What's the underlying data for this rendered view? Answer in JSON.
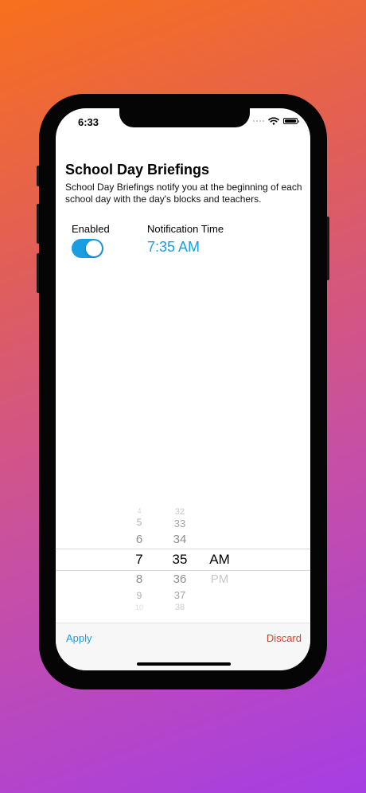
{
  "status_bar": {
    "time": "6:33"
  },
  "header": {
    "title": "School Day Briefings",
    "description": "School Day Briefings notify you at the beginning of each school day with the day's blocks and teachers."
  },
  "settings": {
    "enabled_label": "Enabled",
    "enabled": true,
    "notification_label": "Notification Time",
    "notification_time": "7:35 AM"
  },
  "picker": {
    "hours": [
      "4",
      "5",
      "6",
      "7",
      "8",
      "9",
      "10"
    ],
    "minutes": [
      "32",
      "33",
      "34",
      "35",
      "36",
      "37",
      "38"
    ],
    "periods": [
      "AM",
      "PM"
    ],
    "selected": {
      "hour": "7",
      "minute": "35",
      "period": "AM"
    }
  },
  "toolbar": {
    "apply_label": "Apply",
    "discard_label": "Discard"
  },
  "colors": {
    "accent": "#1a9ee3",
    "destructive": "#e03a2e"
  }
}
